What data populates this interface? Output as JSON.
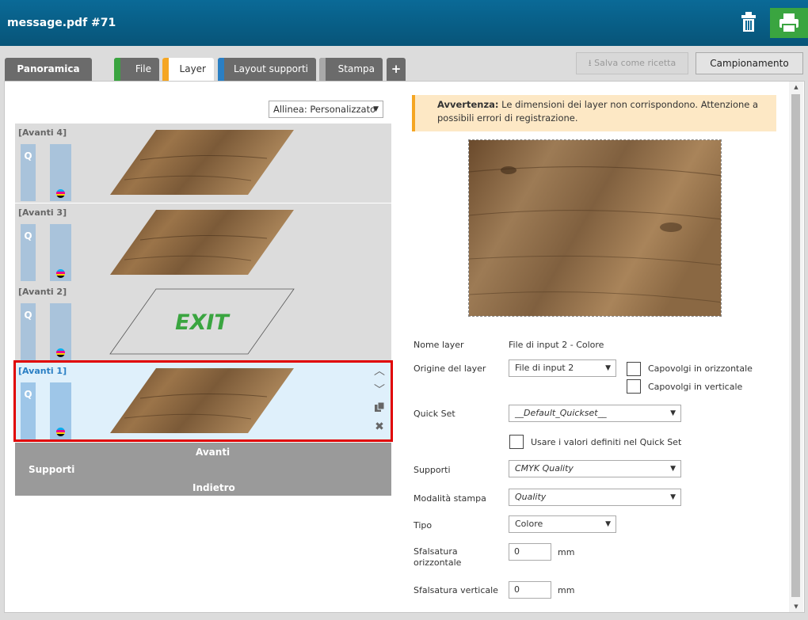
{
  "header": {
    "title": "message.pdf #71",
    "trash_icon": "trash-icon",
    "print_icon": "printer-icon",
    "print_color": "#3aa540"
  },
  "tabs": [
    {
      "label": "Panoramica",
      "strip": ""
    },
    {
      "label": "File",
      "strip": "#3aa540"
    },
    {
      "label": "Layer",
      "strip": "#f5a623"
    },
    {
      "label": "Layout supporti",
      "strip": "#2a7fc4"
    },
    {
      "label": "Stampa",
      "strip": "#a9a9a9"
    },
    {
      "label": "+",
      "strip": ""
    }
  ],
  "toolbar": {
    "save_recipe": "Salva come ricetta",
    "sampling": "Campionamento"
  },
  "align": {
    "value": "Allinea: Personalizzato"
  },
  "layers": [
    {
      "name": "[Avanti 4]",
      "q": "Q",
      "thumb": "wood"
    },
    {
      "name": "[Avanti 3]",
      "q": "Q",
      "thumb": "wood"
    },
    {
      "name": "[Avanti 2]",
      "q": "Q",
      "thumb": "exit",
      "text": "EXIT"
    },
    {
      "name": "[Avanti 1]",
      "q": "Q",
      "thumb": "wood",
      "selected": true
    }
  ],
  "supporti": {
    "front": "Avanti",
    "label": "Supporti",
    "back": "Indietro"
  },
  "warning": {
    "title": "Avvertenza:",
    "text": " Le dimensioni dei layer non corrispondono. Attenzione a possibili errori di registrazione."
  },
  "form": {
    "layer_name_label": "Nome layer",
    "layer_name_value": "File di input 2 - Colore",
    "origin_label": "Origine del layer",
    "origin_value": "File di input 2",
    "flip_h": "Capovolgi in orizzontale",
    "flip_v": "Capovolgi in verticale",
    "quickset_label": "Quick Set",
    "quickset_value": "__Default_Quickset__",
    "use_quickset": "Usare i valori definiti nel Quick Set",
    "media_label": "Supporti",
    "media_value": "CMYK Quality",
    "print_mode_label": "Modalità stampa",
    "print_mode_value": "Quality",
    "type_label": "Tipo",
    "type_value": "Colore",
    "offset_h_label": "Sfalsatura orizzontale",
    "offset_h_value": "0",
    "offset_v_label": "Sfalsatura verticale",
    "offset_v_value": "0",
    "unit": "mm"
  }
}
